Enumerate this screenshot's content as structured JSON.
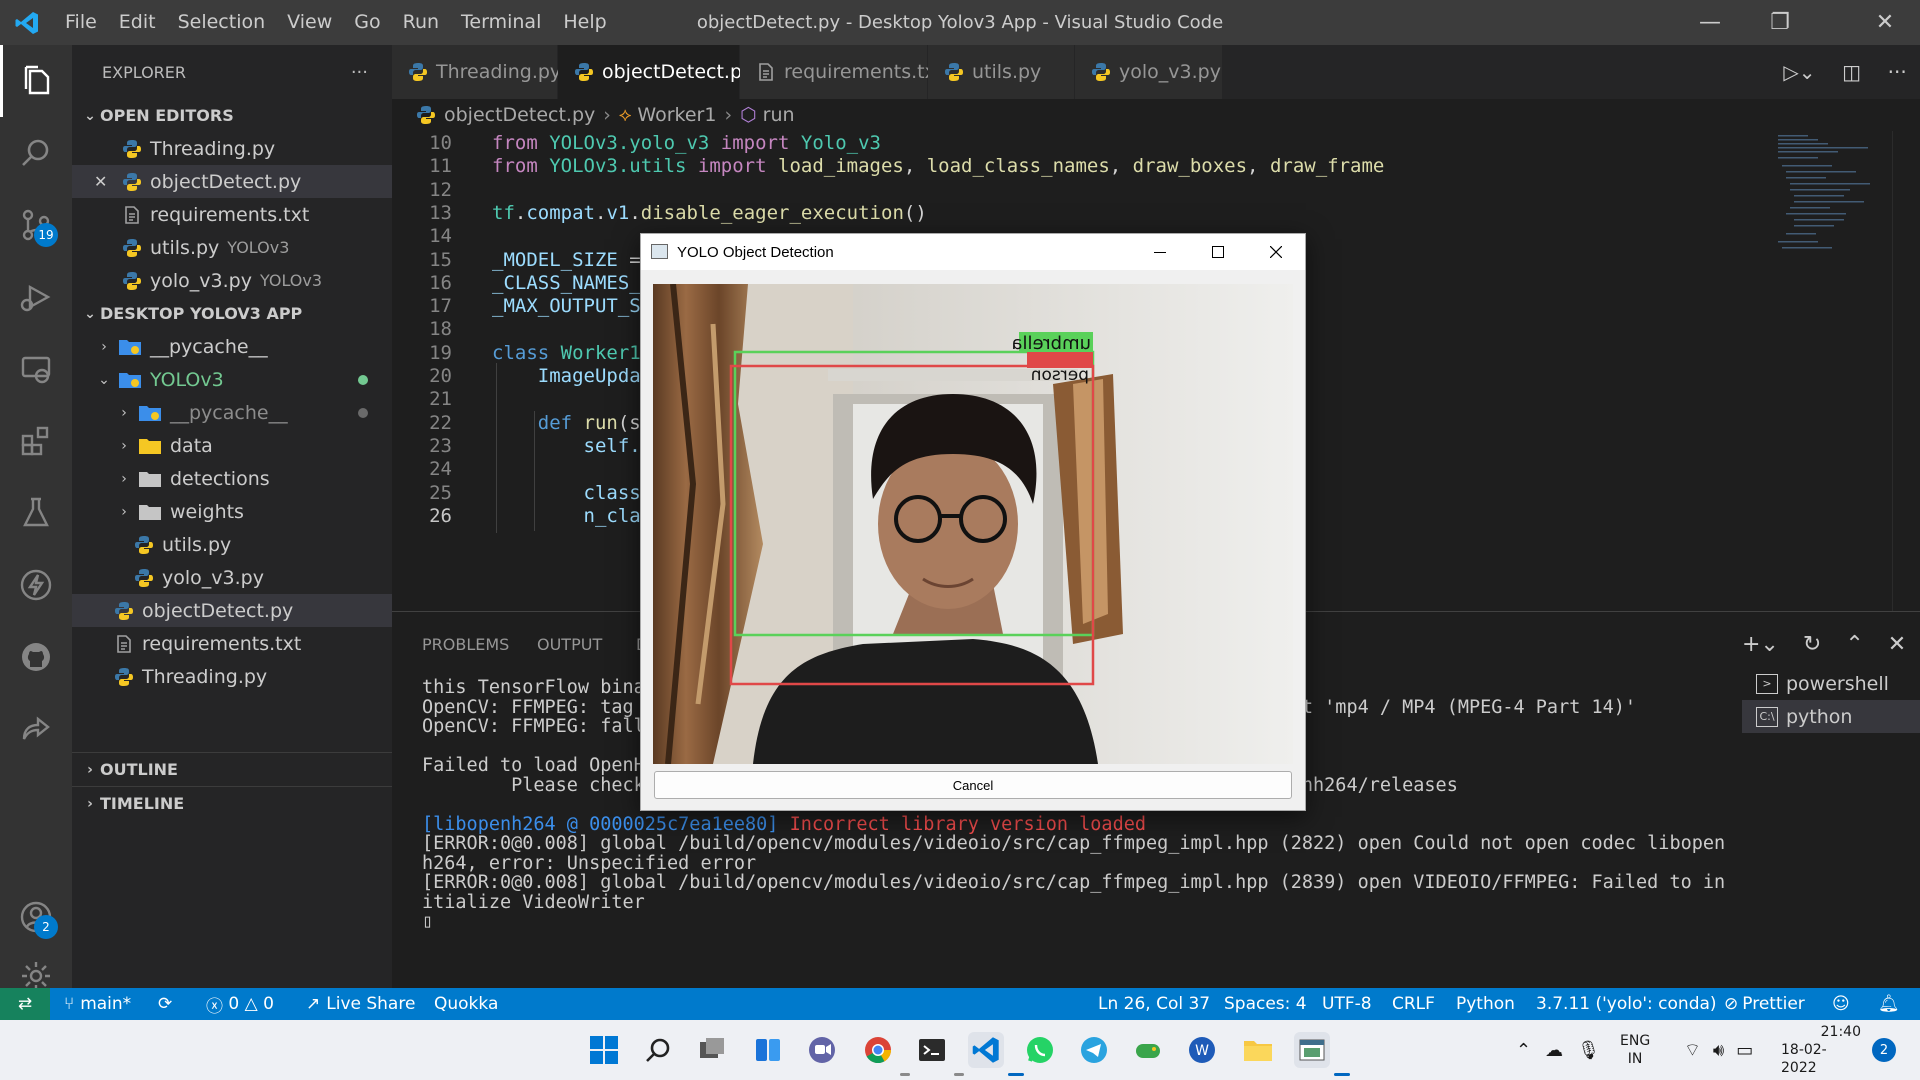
{
  "window": {
    "title": "objectDetect.py - Desktop Yolov3 App - Visual Studio Code",
    "menu": [
      "File",
      "Edit",
      "Selection",
      "View",
      "Go",
      "Run",
      "Terminal",
      "Help"
    ]
  },
  "activity_bar": {
    "scm_badge": "19",
    "accounts_badge": "2"
  },
  "sidebar": {
    "header": "EXPLORER",
    "more": "···",
    "open_editors_title": "OPEN EDITORS",
    "open_editors": [
      {
        "name": "Threading.py",
        "desc": ""
      },
      {
        "name": "objectDetect.py",
        "desc": "",
        "close": "✕"
      },
      {
        "name": "requirements.txt",
        "desc": ""
      },
      {
        "name": "utils.py",
        "desc": "YOLOv3"
      },
      {
        "name": "yolo_v3.py",
        "desc": "YOLOv3"
      }
    ],
    "project_title": "DESKTOP YOLOV3 APP",
    "tree": [
      {
        "name": "__pycache__"
      },
      {
        "name": "YOLOv3"
      },
      {
        "name": "__pycache__"
      },
      {
        "name": "data"
      },
      {
        "name": "detections"
      },
      {
        "name": "weights"
      },
      {
        "name": "utils.py"
      },
      {
        "name": "yolo_v3.py"
      },
      {
        "name": "objectDetect.py"
      },
      {
        "name": "requirements.txt"
      },
      {
        "name": "Threading.py"
      }
    ],
    "outline": "OUTLINE",
    "timeline": "TIMELINE"
  },
  "tabs": [
    {
      "label": "Threading.py"
    },
    {
      "label": "objectDetect.py",
      "close": "✕"
    },
    {
      "label": "requirements.txt"
    },
    {
      "label": "utils.py"
    },
    {
      "label": "yolo_v3.py"
    }
  ],
  "breadcrumb": [
    "objectDetect.py",
    "Worker1",
    "run"
  ],
  "editor": {
    "lines": [
      {
        "n": "10",
        "t": [
          [
            "kw",
            "from "
          ],
          [
            "mod",
            "YOLOv3.yolo_v3 "
          ],
          [
            "kw",
            "import "
          ],
          [
            "mod",
            "Yolo_v3"
          ]
        ]
      },
      {
        "n": "11",
        "t": [
          [
            "kw",
            "from "
          ],
          [
            "mod",
            "YOLOv3.utils "
          ],
          [
            "kw",
            "import "
          ],
          [
            "fn",
            "load_images"
          ],
          [
            "",
            ","
          ],
          [
            "fn",
            " load_class_names"
          ],
          [
            "",
            ", "
          ],
          [
            "fn",
            "draw_boxes"
          ],
          [
            "",
            ", "
          ],
          [
            "fn",
            "draw_frame"
          ]
        ]
      },
      {
        "n": "12",
        "t": []
      },
      {
        "n": "13",
        "t": [
          [
            "mod",
            "tf"
          ],
          [
            "",
            "."
          ],
          [
            "var",
            "compat"
          ],
          [
            "",
            "."
          ],
          [
            "var",
            "v1"
          ],
          [
            "",
            "."
          ],
          [
            "fn",
            "disable_eager_execution"
          ],
          [
            "",
            "()"
          ]
        ]
      },
      {
        "n": "14",
        "t": []
      },
      {
        "n": "15",
        "t": [
          [
            "var",
            "_MODEL_SIZE"
          ],
          [
            "",
            " ="
          ]
        ]
      },
      {
        "n": "16",
        "t": [
          [
            "var",
            "_CLASS_NAMES_"
          ]
        ]
      },
      {
        "n": "17",
        "t": [
          [
            "var",
            "_MAX_OUTPUT_S"
          ]
        ]
      },
      {
        "n": "18",
        "t": []
      },
      {
        "n": "19",
        "t": [
          [
            "kw2",
            "class "
          ],
          [
            "mod",
            "Worker1"
          ]
        ]
      },
      {
        "n": "20",
        "t": [
          [
            "",
            "    "
          ],
          [
            "var",
            "ImageUpda"
          ]
        ]
      },
      {
        "n": "21",
        "t": []
      },
      {
        "n": "22",
        "t": [
          [
            "",
            "    "
          ],
          [
            "kw2",
            "def "
          ],
          [
            "fn",
            "run"
          ],
          [
            "",
            "(s"
          ]
        ]
      },
      {
        "n": "23",
        "t": [
          [
            "",
            "        "
          ],
          [
            "var",
            "self."
          ]
        ]
      },
      {
        "n": "24",
        "t": []
      },
      {
        "n": "25",
        "t": [
          [
            "",
            "        "
          ],
          [
            "var",
            "class"
          ]
        ]
      },
      {
        "n": "26",
        "t": [
          [
            "",
            "        "
          ],
          [
            "var",
            "n_cla"
          ]
        ]
      }
    ]
  },
  "panel": {
    "tabs": [
      "PROBLEMS",
      "OUTPUT",
      "D"
    ],
    "terminal": [
      {
        "c": "",
        "t": "this TensorFlow bina"
      },
      {
        "c": "",
        "t": "OpenCV: FFMPEG: tag                                                           at 'mp4 / MP4 (MPEG-4 Part 14)'"
      },
      {
        "c": "",
        "t": "OpenCV: FFMPEG: fall"
      },
      {
        "c": "",
        "t": ""
      },
      {
        "c": "",
        "t": "Failed to load OpenH"
      },
      {
        "c": "",
        "t": "        Please check                                                     co/openh264/releases"
      },
      {
        "c": "",
        "t": ""
      },
      {
        "c": "mix",
        "a": "[libopenh264 @ 0000025c7ea1ee80] ",
        "b": "Incorrect library version loaded"
      },
      {
        "c": "",
        "t": "[ERROR:0@0.008] global /build/opencv/modules/videoio/src/cap_ffmpeg_impl.hpp (2822) open Could not open codec libopen"
      },
      {
        "c": "",
        "t": "h264, error: Unspecified error"
      },
      {
        "c": "",
        "t": "[ERROR:0@0.008] global /build/opencv/modules/videoio/src/cap_ffmpeg_impl.hpp (2839) open VIDEOIO/FFMPEG: Failed to in"
      },
      {
        "c": "",
        "t": "itialize VideoWriter"
      },
      {
        "c": "",
        "t": "▯"
      }
    ],
    "terminal_list": [
      "powershell",
      "python"
    ]
  },
  "statusbar": {
    "branch": "main*",
    "errors": "0",
    "warnings": "0",
    "live_share": "Live Share",
    "quokka": "Quokka",
    "position": "Ln 26, Col 37",
    "spaces": "Spaces: 4",
    "encoding": "UTF-8",
    "eol": "CRLF",
    "language": "Python",
    "interpreter": "3.7.11 ('yolo': conda)",
    "prettier": "Prettier"
  },
  "dialog": {
    "title": "YOLO Object Detection",
    "label_umbrella": "umbrella",
    "label_person": "person",
    "cancel": "Cancel"
  },
  "taskbar": {
    "lang": "ENG",
    "region": "IN",
    "time": "21:40",
    "date": "18-02-2022",
    "notif": "2"
  }
}
